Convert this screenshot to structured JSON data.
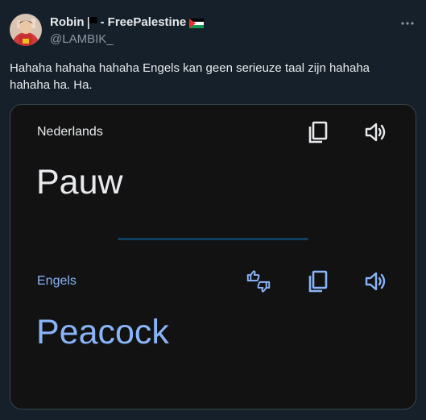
{
  "tweet": {
    "display_name": "Robin",
    "display_suffix": "- FreePalestine",
    "handle": "@LAMBIK_",
    "text": "Hahaha hahaha hahaha Engels kan geen serieuze taal zijn hahaha hahaha ha. Ha."
  },
  "translation_card": {
    "source_language": "Nederlands",
    "source_word": "Pauw",
    "target_language": "Engels",
    "target_word": "Peacock"
  },
  "icons": {
    "more": "more-dots-icon",
    "copy": "copy-icon",
    "speaker": "speaker-icon",
    "feedback": "thumbs-feedback-icon"
  },
  "colors": {
    "background": "#15202b",
    "card_background": "#121212",
    "accent_blue": "#8ab4f8",
    "divider": "#103f5f"
  }
}
